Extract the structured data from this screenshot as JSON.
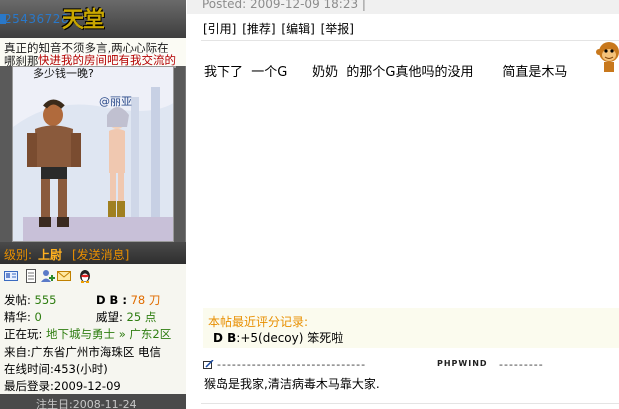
{
  "user": {
    "uid": "254367287",
    "site_logo_text": "天堂",
    "signature_line1": "真正的知音不须多言,两心心际在",
    "signature_line2": "哪刹那",
    "signature_overlay": "快进我的房间吧有我交流的",
    "avatar_caption_top": "多少钱一晚?",
    "avatar_caption_name": "@丽亚",
    "rank_label": "级别:",
    "rank_value": "上尉",
    "send_message": "[发送消息]",
    "stats": {
      "posts_label": "发帖:",
      "posts_value": "555",
      "db_label": "D B :",
      "db_value": "78 刀",
      "elite_label": "精华:",
      "elite_value": "0",
      "prestige_label": "威望:",
      "prestige_value": "25 点",
      "playing_label": "正在玩:",
      "playing_game": "地下城与勇士",
      "playing_region": "» 广东2区",
      "from": "来自:广东省广州市海珠区 电信",
      "online": "在线时间:453(小时)",
      "last_login": "最后登录:2009-12-09"
    },
    "registered": "注生日:2008-11-24"
  },
  "post": {
    "posted": "Posted: 2009-12-09 18:23 |",
    "actions": [
      "[引用]",
      "[推荐]",
      "[编辑]",
      "[举报]"
    ],
    "content": "我下了  一个G      奶奶  的那个G真他吗的没用       简直是木马",
    "rating_title": "本帖最近评分记录:",
    "rating_db": "D B",
    "rating_entry": ":+5(decoy) 笨死啦",
    "sig_dashes_left": "------------------------------",
    "sig_brand": "PHPWIND",
    "sig_dashes_right": "---------",
    "signature": "猴岛是我家,清洁病毒木马靠大家."
  },
  "colors": {
    "rank_orange": "#e88f00",
    "stat_green": "#2e7d10",
    "uid_blue": "#2a78c8"
  },
  "icons": [
    "profile-card-icon",
    "document-icon",
    "add-friend-icon",
    "email-icon",
    "qq-penguin-icon",
    "monkey-emoticon-icon",
    "signature-pen-icon"
  ]
}
